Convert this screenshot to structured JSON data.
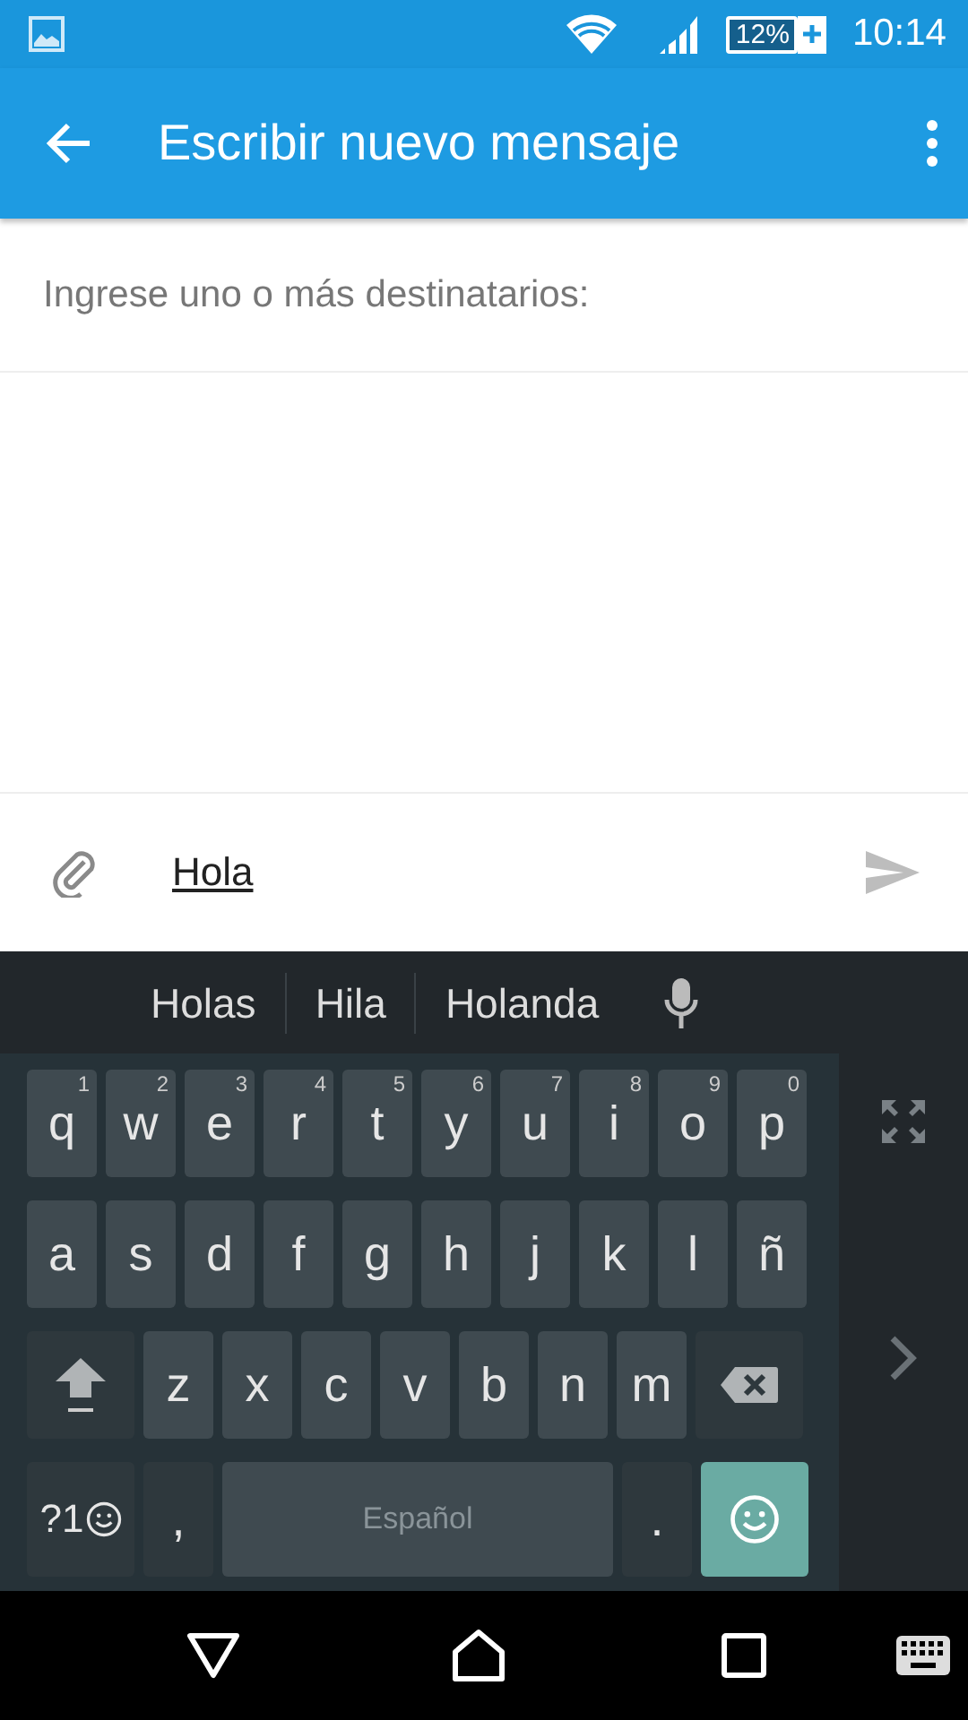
{
  "status_bar": {
    "battery": "12%",
    "charging": true,
    "time": "10:14"
  },
  "app_bar": {
    "title": "Escribir nuevo mensaje"
  },
  "recipients": {
    "placeholder": "Ingrese uno o más destinatarios:"
  },
  "compose": {
    "value": "Hola"
  },
  "keyboard": {
    "suggestions": [
      "Holas",
      "Hila",
      "Holanda"
    ],
    "rows": [
      [
        {
          "kind": "letter",
          "label": "q",
          "hint": "1"
        },
        {
          "kind": "letter",
          "label": "w",
          "hint": "2"
        },
        {
          "kind": "letter",
          "label": "e",
          "hint": "3"
        },
        {
          "kind": "letter",
          "label": "r",
          "hint": "4"
        },
        {
          "kind": "letter",
          "label": "t",
          "hint": "5"
        },
        {
          "kind": "letter",
          "label": "y",
          "hint": "6"
        },
        {
          "kind": "letter",
          "label": "u",
          "hint": "7"
        },
        {
          "kind": "letter",
          "label": "i",
          "hint": "8"
        },
        {
          "kind": "letter",
          "label": "o",
          "hint": "9"
        },
        {
          "kind": "letter",
          "label": "p",
          "hint": "0"
        }
      ],
      [
        {
          "kind": "letter",
          "label": "a"
        },
        {
          "kind": "letter",
          "label": "s"
        },
        {
          "kind": "letter",
          "label": "d"
        },
        {
          "kind": "letter",
          "label": "f"
        },
        {
          "kind": "letter",
          "label": "g"
        },
        {
          "kind": "letter",
          "label": "h"
        },
        {
          "kind": "letter",
          "label": "j"
        },
        {
          "kind": "letter",
          "label": "k"
        },
        {
          "kind": "letter",
          "label": "l"
        },
        {
          "kind": "letter",
          "label": "ñ"
        }
      ],
      [
        {
          "kind": "shift"
        },
        {
          "kind": "letter",
          "label": "z"
        },
        {
          "kind": "letter",
          "label": "x"
        },
        {
          "kind": "letter",
          "label": "c"
        },
        {
          "kind": "letter",
          "label": "v"
        },
        {
          "kind": "letter",
          "label": "b"
        },
        {
          "kind": "letter",
          "label": "n"
        },
        {
          "kind": "letter",
          "label": "m"
        },
        {
          "kind": "backspace"
        }
      ]
    ],
    "bottom_bar": {
      "keys": [
        {
          "kind": "symbols",
          "label": "?1"
        },
        {
          "kind": "punct",
          "label": ","
        },
        {
          "kind": "space",
          "label": "Español"
        },
        {
          "kind": "punct",
          "label": "."
        },
        {
          "kind": "emoji"
        }
      ]
    }
  }
}
